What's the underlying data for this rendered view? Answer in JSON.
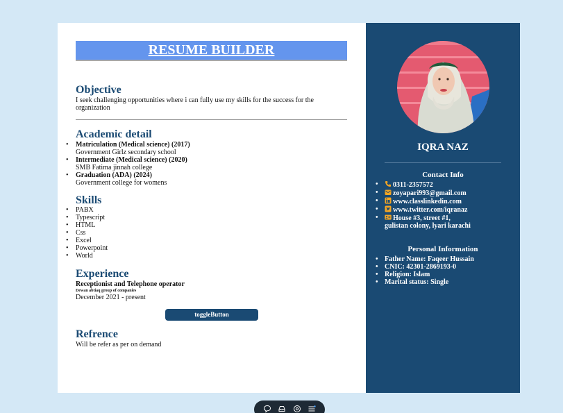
{
  "main": {
    "banner_title": "RESUME BUILDER",
    "objective": {
      "title": "Objective",
      "text": "I seek challenging opportunities where i can fully use my skills for the success for the organization"
    },
    "academic": {
      "title": "Academic detail",
      "items": [
        {
          "degree": "Matriculation (Medical science) (2017)",
          "institution": "Government Girlz secondary school"
        },
        {
          "degree": "Intermediate (Medical science) (2020)",
          "institution": "SMB Fatima jinnah college"
        },
        {
          "degree": "Graduation (ADA) (2024)",
          "institution": "Government college for womens"
        }
      ]
    },
    "skills": {
      "title": "Skills",
      "items": [
        "PABX",
        "Typescript",
        "HTML",
        "Css",
        "Excel",
        "Powerpoint",
        "World"
      ]
    },
    "experience": {
      "title": "Experience",
      "role": "Receptionist and Telephone operator",
      "company": "Dewan abtiaq group of companies",
      "period": "December 2021 - present"
    },
    "toggle_label": "toggleButton",
    "reference": {
      "title": "Refrence",
      "text": "Will be refer as per on demand"
    }
  },
  "sidebar": {
    "name": "IQRA NAZ",
    "contact": {
      "title": "Contact Info",
      "phone": "0311-2357572",
      "email": "zoyapari993@gmail.com",
      "linkedin": "www.classlinkedin.com",
      "twitter": "www.twitter.com/iqranaz",
      "address_line1": "House #3, street #1,",
      "address_line2": "gulistan colony, lyari karachi"
    },
    "personal": {
      "title": "Personal Information",
      "items": [
        "Father Name: Faqeer Hussain",
        "CNIC: 42301-2869193-0",
        "Religion: Islam",
        "Marital status: Single"
      ]
    }
  },
  "colors": {
    "page_bg": "#d4e8f6",
    "sidebar_bg": "#1a4a73",
    "banner_bg": "#6495ed",
    "section_title": "#1a4a73",
    "icon_accent": "#f5a623"
  },
  "icons": {
    "phone": "phone-icon",
    "email": "email-icon",
    "linkedin": "linkedin-icon",
    "twitter": "twitter-icon",
    "address": "address-card-icon"
  }
}
